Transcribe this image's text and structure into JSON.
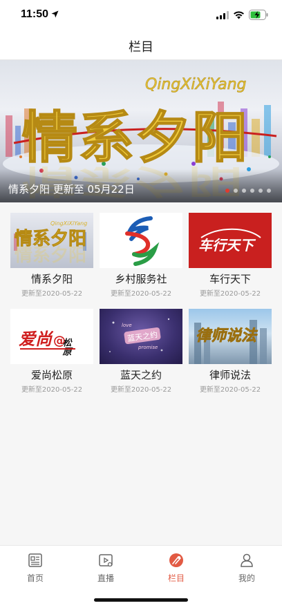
{
  "status": {
    "time": "11:50"
  },
  "nav": {
    "title": "栏目"
  },
  "banner": {
    "caption": "情系夕阳 更新至 05月22日",
    "logo_cn": "情系夕阳",
    "logo_en": "QingXiXiYang",
    "dots": 6,
    "active_dot": 0
  },
  "programs": [
    {
      "title": "情系夕阳",
      "date": "更新至2020-05-22",
      "thumb_text": "情系夕阳",
      "thumb_en": "QingXiXiYang"
    },
    {
      "title": "乡村服务社",
      "date": "更新至2020-05-22"
    },
    {
      "title": "车行天下",
      "date": "更新至2020-05-22",
      "thumb_text": "车行天下"
    },
    {
      "title": "爱尚松原",
      "date": "更新至2020-05-22",
      "thumb_text": "爱尚",
      "thumb_at": "@",
      "thumb_side": "松原"
    },
    {
      "title": "蓝天之约",
      "date": "更新至2020-05-22",
      "thumb_text": "蓝天之约",
      "thumb_en1": "love",
      "thumb_en2": "promise"
    },
    {
      "title": "律师说法",
      "date": "更新至2020-05-22",
      "thumb_text": "律师说法"
    }
  ],
  "tabs": [
    {
      "label": "首页",
      "icon": "news-icon"
    },
    {
      "label": "直播",
      "icon": "video-icon"
    },
    {
      "label": "栏目",
      "icon": "column-icon",
      "active": true
    },
    {
      "label": "我的",
      "icon": "user-icon"
    }
  ],
  "colors": {
    "accent": "#e25a43",
    "car_red": "#c9201f",
    "gold": "#e6c33a"
  }
}
